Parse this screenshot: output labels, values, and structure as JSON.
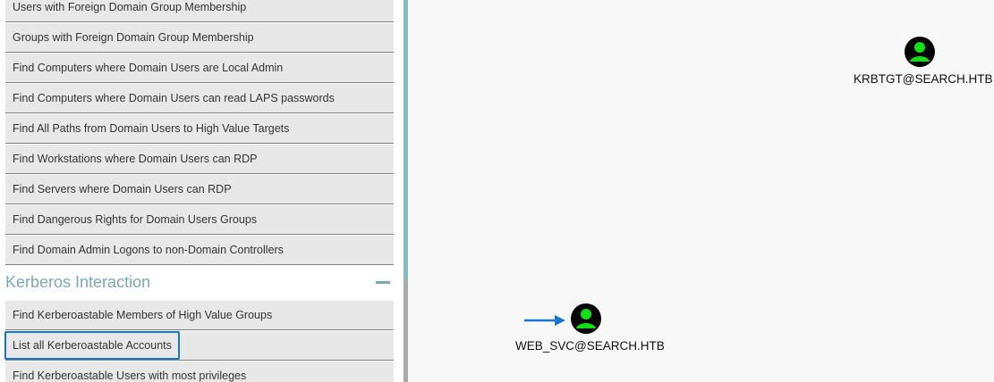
{
  "sidebar": {
    "queries_top": [
      "Users with Foreign Domain Group Membership",
      "Groups with Foreign Domain Group Membership",
      "Find Computers where Domain Users are Local Admin",
      "Find Computers where Domain Users can read LAPS passwords",
      "Find All Paths from Domain Users to High Value Targets",
      "Find Workstations where Domain Users can RDP",
      "Find Servers where Domain Users can RDP",
      "Find Dangerous Rights for Domain Users Groups",
      "Find Domain Admin Logons to non-Domain Controllers"
    ],
    "kerberos_section": {
      "title": "Kerberos Interaction",
      "collapse_icon": "minus-icon",
      "queries": [
        "Find Kerberoastable Members of High Value Groups",
        "List all Kerberoastable Accounts",
        "Find Kerberoastable Users with most privileges"
      ]
    }
  },
  "graph": {
    "nodes": [
      {
        "label": "KRBTGT@SEARCH.HTB",
        "icon": "user-icon"
      },
      {
        "label": "WEB_SVC@SEARCH.HTB",
        "icon": "user-icon"
      }
    ],
    "pointer_icon": "arrow-right-icon"
  },
  "colors": {
    "node_fill": "#12e012",
    "node_bg": "#000000",
    "section_title": "#7aa9b9",
    "highlight": "#1a75d1",
    "arrow": "#1a75d1"
  }
}
